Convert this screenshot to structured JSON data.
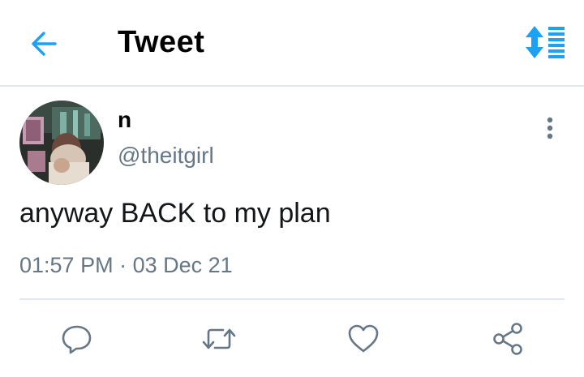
{
  "header": {
    "title": "Tweet",
    "back_icon": "arrow-left-icon",
    "sort_icon": "sort-timeline-icon"
  },
  "tweet": {
    "author": {
      "display_name": "n",
      "handle": "@theitgirl"
    },
    "text": "anyway BACK to my plan",
    "time": "01:57 PM",
    "separator": " · ",
    "date": "03 Dec 21"
  },
  "actions": [
    {
      "icon": "reply-icon"
    },
    {
      "icon": "retweet-icon"
    },
    {
      "icon": "like-heart-icon"
    },
    {
      "icon": "share-icon"
    }
  ],
  "colors": {
    "accent": "#1da1f2",
    "text_primary": "#14171a",
    "text_secondary": "#657786",
    "divider": "#e1e8ed"
  }
}
